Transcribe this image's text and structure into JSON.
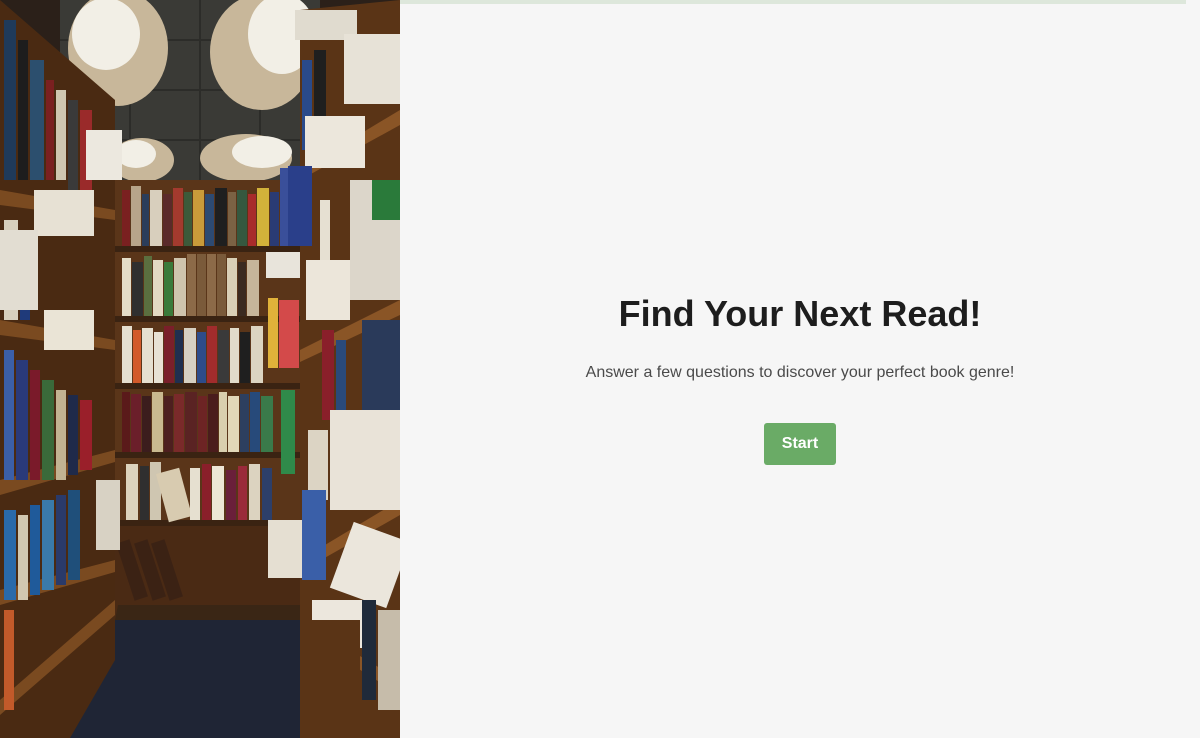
{
  "hero": {
    "image_description": "library-aisle-photo"
  },
  "progress": {
    "value": 0,
    "label": "0%"
  },
  "intro": {
    "title": "Find Your Next Read!",
    "subtitle": "Answer a few questions to discover your perfect book genre!",
    "start_label": "Start"
  },
  "navigation": {
    "prev_icon": "chevron-left-icon",
    "next_icon": "chevron-right-icon",
    "prev_enabled": false,
    "next_enabled": true
  },
  "colors": {
    "accent": "#6aab66",
    "accent_light": "#cfe0cc",
    "track": "#dde7db",
    "background": "#f6f6f6",
    "title": "#1d1d1d",
    "text": "#4a4a4a"
  }
}
